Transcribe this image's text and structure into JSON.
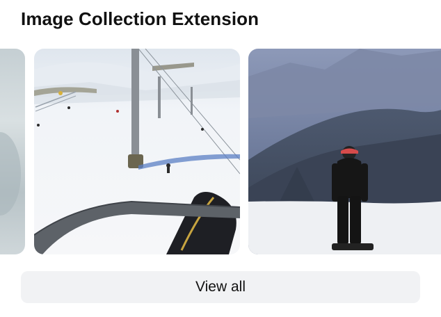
{
  "section": {
    "title": "Image Collection Extension"
  },
  "images": [
    {
      "name": "partial-image-left",
      "subject": "snowy blurred landscape"
    },
    {
      "name": "ski-lift-image",
      "subject": "ski slope viewed from a chairlift with a snowboard"
    },
    {
      "name": "snowboarder-image",
      "subject": "snowboarder standing on a snowy mountain ridge"
    }
  ],
  "actions": {
    "view_all_label": "View all"
  }
}
